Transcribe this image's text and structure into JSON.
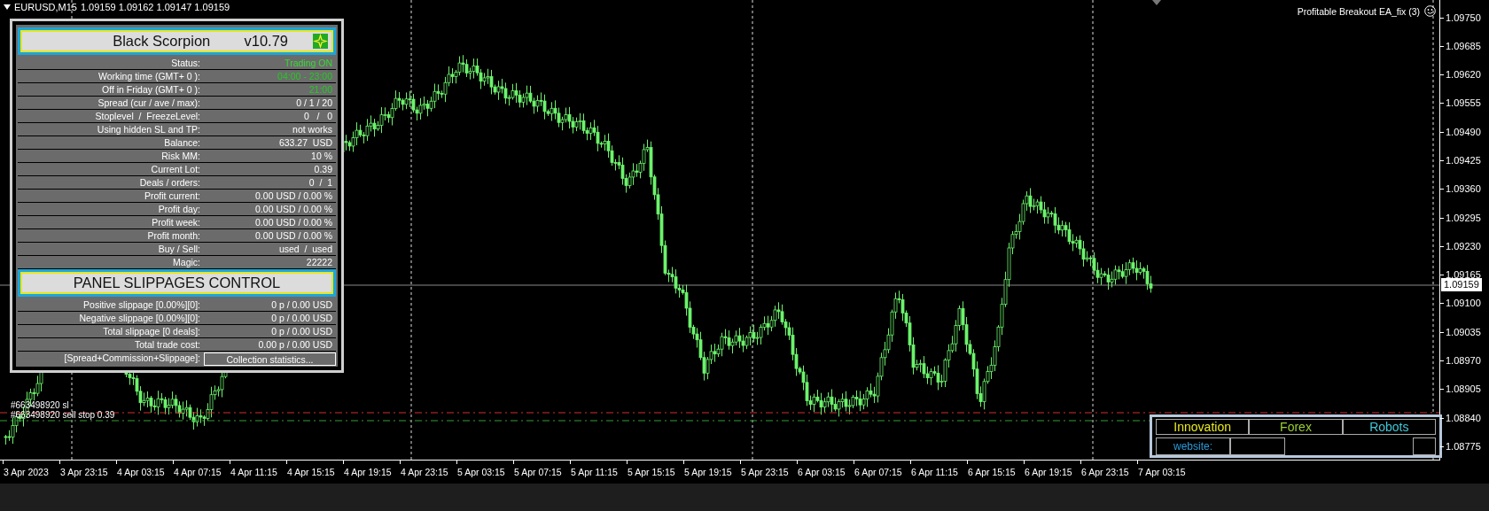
{
  "chart": {
    "symbol": "EURUSD,M15",
    "quote": "1.09159 1.09162 1.09147 1.09159",
    "expert": "Profitable Breakout EA_fix (3)",
    "price_labels": [
      "1.09750",
      "1.09685",
      "1.09620",
      "1.09555",
      "1.09490",
      "1.09425",
      "1.09360",
      "1.09295",
      "1.09230",
      "1.09165",
      "1.09100",
      "1.09035",
      "1.08970",
      "1.08905",
      "1.08840",
      "1.08775"
    ],
    "current_price": "1.09159",
    "time_labels": [
      "3 Apr 2023",
      "3 Apr 23:15",
      "4 Apr 03:15",
      "4 Apr 07:15",
      "4 Apr 11:15",
      "4 Apr 15:15",
      "4 Apr 19:15",
      "4 Apr 23:15",
      "5 Apr 03:15",
      "5 Apr 07:15",
      "5 Apr 11:15",
      "5 Apr 15:15",
      "5 Apr 19:15",
      "5 Apr 23:15",
      "6 Apr 03:15",
      "6 Apr 07:15",
      "6 Apr 11:15",
      "6 Apr 15:15",
      "6 Apr 19:15",
      "6 Apr 23:15",
      "7 Apr 03:15"
    ],
    "order_labels": [
      "#663498920 sl",
      "#663498920 sell stop 0.39"
    ]
  },
  "panel": {
    "title": "Black Scorpion",
    "version": "v10.79",
    "rows": [
      {
        "label": "Status:",
        "value": "Trading ON",
        "color": "#33dd33"
      },
      {
        "label": "Working time (GMT+ 0 ):",
        "value": "04:00 - 23:00",
        "color": "#22cc22"
      },
      {
        "label": "Off in Friday (GMT+ 0 ):",
        "value": "21:00",
        "color": "#22cc22"
      },
      {
        "label": "Spread (cur / ave / max):",
        "value": "0 / 1 / 20"
      },
      {
        "label": "Stoplevel  /  FreezeLevel:",
        "value": "0   /   0"
      },
      {
        "label": "Using hidden SL and TP:",
        "value": "not works"
      },
      {
        "label": "Balance:",
        "value": "633.27  USD"
      },
      {
        "label": "Risk MM:",
        "value": "10 %"
      },
      {
        "label": "Current Lot:",
        "value": "0.39"
      },
      {
        "label": "Deals / orders:",
        "value": "0  /  1"
      },
      {
        "label": "Profit current:",
        "value": "0.00 USD / 0.00 %"
      },
      {
        "label": "Profit day:",
        "value": "0.00 USD / 0.00 %"
      },
      {
        "label": "Profit week:",
        "value": "0.00 USD / 0.00 %"
      },
      {
        "label": "Profit month:",
        "value": "0.00 USD / 0.00 %"
      },
      {
        "label": "Buy / Sell:",
        "value": "used  /  used"
      },
      {
        "label": "Magic:",
        "value": "22222"
      }
    ],
    "section_title": "PANEL SLIPPAGES CONTROL",
    "slippage_rows": [
      {
        "label": "Positive slippage [0.00%][0]:",
        "value": "0 p / 0.00 USD",
        "kind": "text"
      },
      {
        "label": "Negative slippage [0.00%][0]:",
        "value": "0 p / 0.00 USD",
        "kind": "text"
      },
      {
        "label": "Total slippage [0 deals]:",
        "value": "0 p / 0.00 USD",
        "kind": "text"
      },
      {
        "label": "Total trade cost:",
        "value": "0.00 p / 0.00 USD",
        "kind": "text"
      },
      {
        "label": "[Spread+Commission+Slippage]:",
        "value": "Collection statistics...",
        "kind": "button"
      }
    ]
  },
  "banner": {
    "cells": [
      {
        "text": "Innovation",
        "color": "#e8e820"
      },
      {
        "text": "Forex",
        "color": "#9acd32"
      },
      {
        "text": "Robots",
        "color": "#40c8d8"
      }
    ],
    "website_label": {
      "text": "website:",
      "color": "#2a9ad8"
    }
  }
}
